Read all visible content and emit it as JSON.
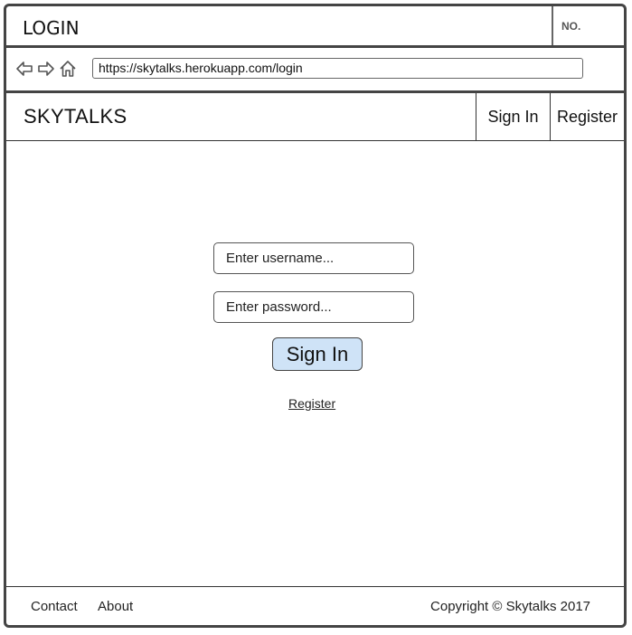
{
  "window": {
    "title": "LOGIN",
    "number_label": "NO."
  },
  "browser": {
    "url": "https://skytalks.herokuapp.com/login",
    "icons": [
      "back-arrow-icon",
      "forward-arrow-icon",
      "home-icon"
    ]
  },
  "header": {
    "brand": "SKYTALKS",
    "sign_in_label": "Sign In",
    "register_label": "Register"
  },
  "form": {
    "username_placeholder": "Enter username...",
    "password_placeholder": "Enter password...",
    "sign_in_label": "Sign In",
    "register_link": "Register"
  },
  "footer": {
    "contact": "Contact",
    "about": "About",
    "copyright": "Copyright © Skytalks 2017"
  },
  "colors": {
    "border": "#444444",
    "button_fill": "#cfe3f7"
  }
}
